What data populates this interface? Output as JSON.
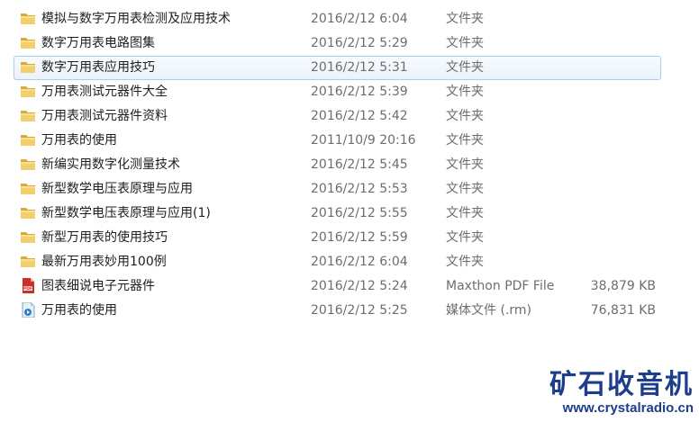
{
  "files": [
    {
      "name": "模拟与数字万用表检测及应用技术",
      "date": "2016/2/12 6:04",
      "type": "文件夹",
      "size": "",
      "icon": "folder-icon",
      "selected": false
    },
    {
      "name": "数字万用表电路图集",
      "date": "2016/2/12 5:29",
      "type": "文件夹",
      "size": "",
      "icon": "folder-icon",
      "selected": false
    },
    {
      "name": "数字万用表应用技巧",
      "date": "2016/2/12 5:31",
      "type": "文件夹",
      "size": "",
      "icon": "folder-icon",
      "selected": true
    },
    {
      "name": "万用表测试元器件大全",
      "date": "2016/2/12 5:39",
      "type": "文件夹",
      "size": "",
      "icon": "folder-icon",
      "selected": false
    },
    {
      "name": "万用表测试元器件资料",
      "date": "2016/2/12 5:42",
      "type": "文件夹",
      "size": "",
      "icon": "folder-icon",
      "selected": false
    },
    {
      "name": "万用表的使用",
      "date": "2011/10/9 20:16",
      "type": "文件夹",
      "size": "",
      "icon": "folder-icon",
      "selected": false
    },
    {
      "name": "新编实用数字化测量技术",
      "date": "2016/2/12 5:45",
      "type": "文件夹",
      "size": "",
      "icon": "folder-icon",
      "selected": false
    },
    {
      "name": "新型数学电压表原理与应用",
      "date": "2016/2/12 5:53",
      "type": "文件夹",
      "size": "",
      "icon": "folder-icon",
      "selected": false
    },
    {
      "name": "新型数学电压表原理与应用(1)",
      "date": "2016/2/12 5:55",
      "type": "文件夹",
      "size": "",
      "icon": "folder-icon",
      "selected": false
    },
    {
      "name": "新型万用表的使用技巧",
      "date": "2016/2/12 5:59",
      "type": "文件夹",
      "size": "",
      "icon": "folder-icon",
      "selected": false
    },
    {
      "name": "最新万用表妙用100例",
      "date": "2016/2/12 6:04",
      "type": "文件夹",
      "size": "",
      "icon": "folder-icon",
      "selected": false
    },
    {
      "name": "图表细说电子元器件",
      "date": "2016/2/12 5:24",
      "type": "Maxthon PDF File",
      "size": "38,879 KB",
      "icon": "pdf-file-icon",
      "selected": false
    },
    {
      "name": "万用表的使用",
      "date": "2016/2/12 5:25",
      "type": "媒体文件 (.rm)",
      "size": "76,831 KB",
      "icon": "media-file-icon",
      "selected": false
    }
  ],
  "watermark": {
    "title": "矿石收音机",
    "url": "www.crystalradio.cn"
  },
  "colors": {
    "selection_border": "#a9cdea",
    "folder": "#e8c25a",
    "pdf": "#d4312a",
    "watermark": "#1c3e8c"
  }
}
